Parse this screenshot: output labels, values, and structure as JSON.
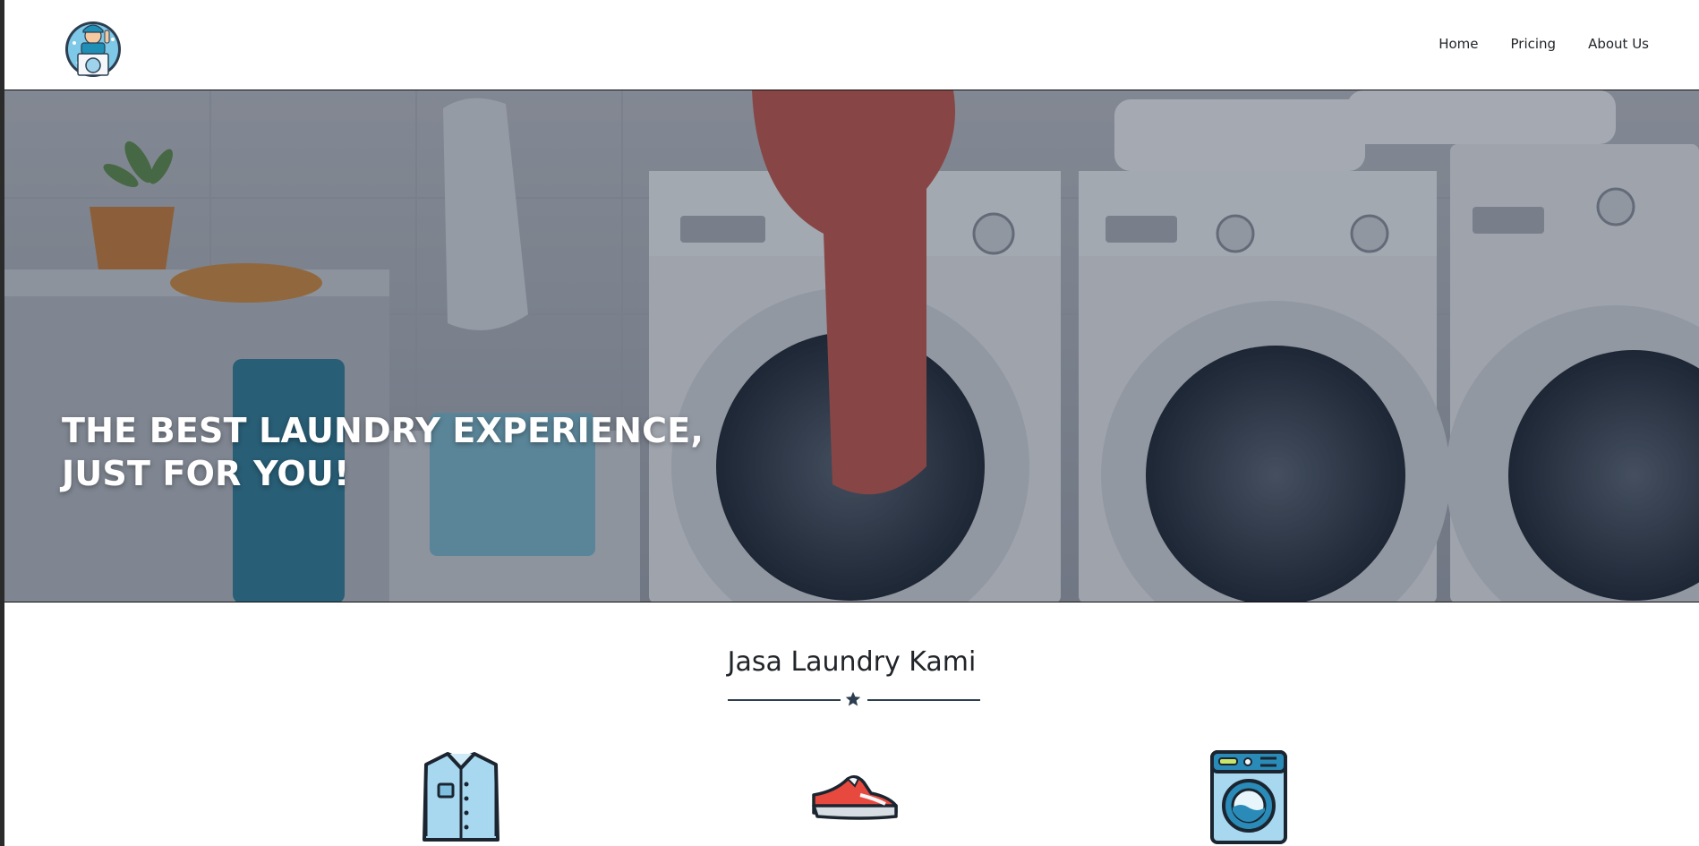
{
  "nav": {
    "logo_icon": "laundry-mascot-logo",
    "links": [
      "Home",
      "Pricing",
      "About Us"
    ]
  },
  "hero": {
    "title_line1": "THE BEST LAUNDRY EXPERIENCE,",
    "title_line2": "JUST FOR YOU!"
  },
  "services": {
    "title": "Jasa Laundry Kami",
    "divider_icon": "star-icon",
    "icons": [
      "shirt-icon",
      "sneaker-icon",
      "washing-machine-icon"
    ]
  },
  "colors": {
    "text": "#212529",
    "accent": "#2c3e50",
    "hero_overlay": "#1e283c"
  }
}
